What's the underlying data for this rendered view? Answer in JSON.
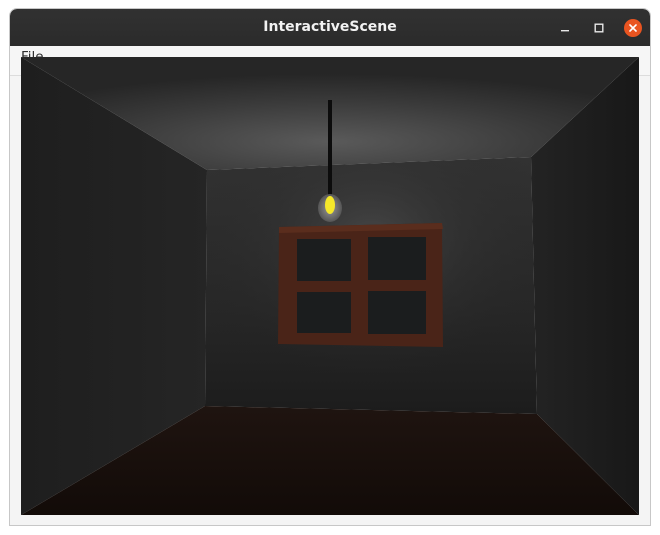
{
  "window": {
    "title": "InteractiveScene"
  },
  "menubar": {
    "items": [
      {
        "label": "File"
      }
    ]
  },
  "titlebar_buttons": {
    "minimize_icon": "minimize-icon",
    "maximize_icon": "maximize-icon",
    "close_icon": "close-icon"
  },
  "colors": {
    "titlebar": "#2c2c2c",
    "close_accent": "#e95420",
    "bulb_glow": "#f5e82a",
    "window_frame": "#4a2418"
  }
}
